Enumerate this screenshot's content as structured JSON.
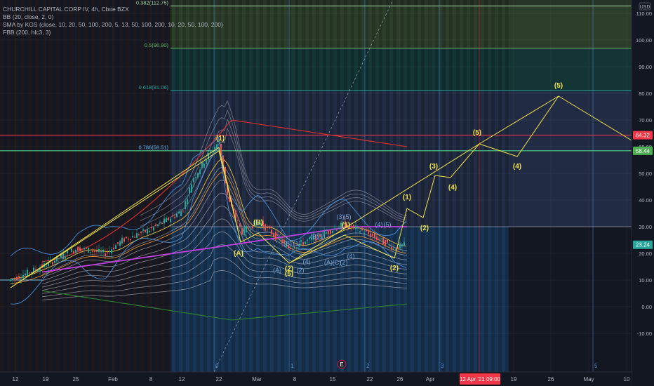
{
  "legend": {
    "symbol": "CHURCHILL CAPITAL CORP IV, 4h, Cboe BZX",
    "bb": "BB (20, close, 2, 0)",
    "sma": "SMA by KGS (close, 10, 20, 50, 100, 200, 5, 13, 50, 100, 200, 10, 20, 50, 100, 200)",
    "fbb": "FBB (200, hlc3, 3)"
  },
  "price_axis": {
    "currency": "USD",
    "ticks": [
      "110.00",
      "100.00",
      "90.00",
      "80.00",
      "70.00",
      "60.00",
      "50.00",
      "40.00",
      "30.00",
      "20.00",
      "10.00",
      "0.00",
      "-10.00"
    ],
    "tick_values": [
      110,
      100,
      90,
      80,
      70,
      60,
      50,
      40,
      30,
      20,
      10,
      0,
      -10
    ],
    "markers": [
      {
        "label": "64.32",
        "value": 64.32,
        "color": "#f23645"
      },
      {
        "label": "58.44",
        "value": 58.44,
        "color": "#4caf50"
      },
      {
        "label": "23.24",
        "value": 23.24,
        "color": "#26a69a"
      }
    ]
  },
  "time_axis": {
    "labels": [
      "12",
      "19",
      "25",
      "Feb",
      "8",
      "12",
      "22",
      "Mar",
      "8",
      "15",
      "22",
      "26",
      "Apr",
      "19",
      "26",
      "May",
      "10"
    ],
    "crosshair_badge": "12 Apr '21  09:00",
    "crosshair_color": "#f23645"
  },
  "fib_levels": [
    {
      "label": "0.382(112.75)",
      "value": 112.75,
      "color": "#a5d6a7"
    },
    {
      "label": "0.5(96.90)",
      "value": 96.9,
      "color": "#66bb6a"
    },
    {
      "label": "0.618(81.06)",
      "value": 81.06,
      "color": "#26a69a"
    },
    {
      "label": "0.786(58.51)",
      "value": 58.51,
      "color": "#64b5f6"
    }
  ],
  "cycle_labels": [
    "0",
    "1",
    "2",
    "3",
    "5"
  ],
  "earnings_icon": "E",
  "waves": {
    "major": [
      "(1)",
      "(A)",
      "(B)",
      "(5)",
      "(1)",
      "(2)",
      "(1)",
      "(2)",
      "(3)",
      "(4)",
      "(5)",
      "(4)",
      "(5)",
      "(2)"
    ],
    "minor": [
      "(3)",
      "(5)",
      "(B)",
      "(1)",
      "(B)",
      "(1)",
      "(4)",
      "(A)",
      "(C)",
      "(2)",
      "(4)",
      "(2)",
      "(A)",
      "(4)",
      "(5)"
    ]
  },
  "last_price": 23.24
}
